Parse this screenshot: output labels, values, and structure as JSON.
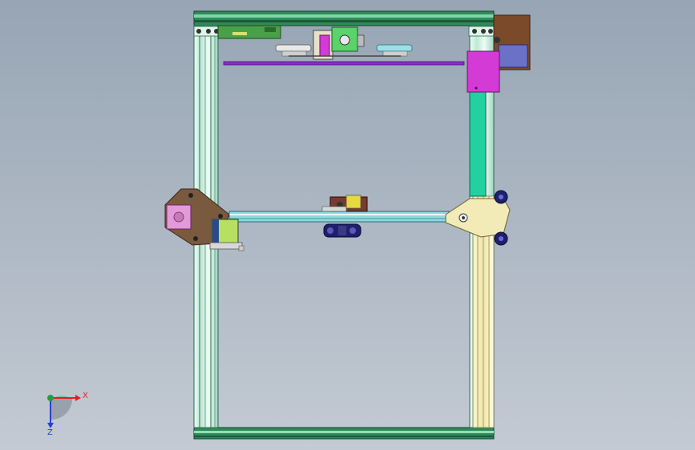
{
  "viewport": {
    "background_top": "#97a5b4",
    "background_bottom": "#c3cad3"
  },
  "triad": {
    "x_label": "X",
    "z_label": "Z",
    "x_color": "#e02020",
    "y_color": "#1fa03a",
    "z_color": "#2a3fd0"
  },
  "colors": {
    "frame_green": "#2f8a5a",
    "extrusion_light": "#cfeee2",
    "carriage_purple": "#8a2ad0",
    "block_magenta": "#d43ad6",
    "motor_brown": "#7a4a2a",
    "plate_brown": "#7a5a3e",
    "stepper_pink": "#e49ad8",
    "gantry_cream": "#f2ebb8",
    "wheel_navy": "#1f1f70",
    "crossbar_cyan": "#8fd8df",
    "teal_rail": "#22d0a0"
  }
}
